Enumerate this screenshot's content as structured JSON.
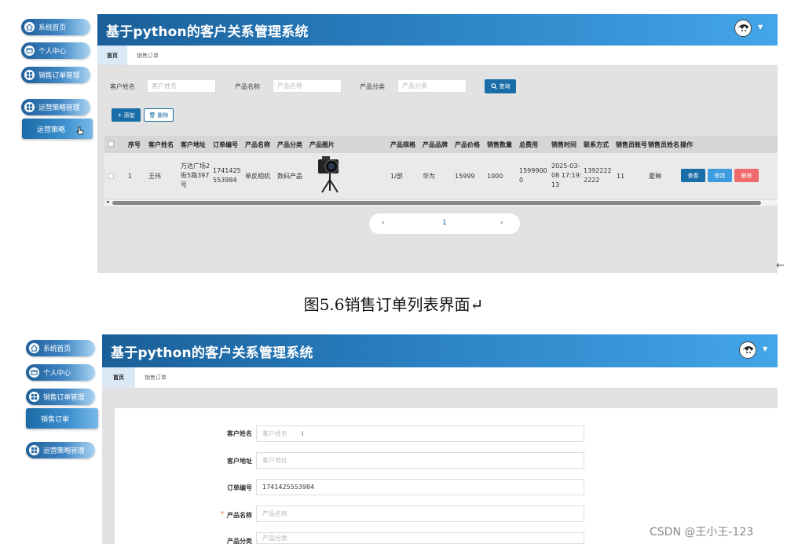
{
  "app_title": "基于python的客户关系管理系统",
  "sidebar": {
    "items": [
      "系统首页",
      "个人中心",
      "销售订单管理",
      "运营策略管理"
    ],
    "sub_strategy": "运营策略",
    "sub_order": "销售订单"
  },
  "tabs": [
    "首页",
    "销售订单"
  ],
  "filters": [
    {
      "label": "客户姓名",
      "placeholder": "客户姓名"
    },
    {
      "label": "产品名称",
      "placeholder": "产品名称"
    },
    {
      "label": "产品分类",
      "placeholder": "产品分类"
    }
  ],
  "query_label": "查询",
  "add_label": "+ 添加",
  "delete_label": "删除",
  "table": {
    "headers": [
      "序号",
      "客户姓名",
      "客户地址",
      "订单编号",
      "产品名称",
      "产品分类",
      "产品图片",
      "产品规格",
      "产品品牌",
      "产品价格",
      "销售数量",
      "总费用",
      "销售时间",
      "联系方式",
      "销售员账号",
      "销售员姓名",
      "操作"
    ],
    "row": {
      "index": "1",
      "customer": "王伟",
      "address": "万达广场2街5路397号",
      "order_no": "1741425553984",
      "product": "单反相机",
      "category": "数码产品",
      "spec": "1/部",
      "brand": "华为",
      "price": "15999",
      "qty": "1000",
      "total": "15999000",
      "time": "2025-03-08 17:19:13",
      "phone": "13922222222",
      "seller_account": "11",
      "seller_name": "夏琳"
    },
    "actions": [
      "查看",
      "修改",
      "删除"
    ]
  },
  "pager": {
    "prev": "‹",
    "page": "1",
    "next": "›"
  },
  "caption": "图5.6销售订单列表界面↵",
  "form": {
    "fields": [
      {
        "label": "客户姓名",
        "value": "",
        "placeholder": "客户姓名",
        "required": false
      },
      {
        "label": "客户地址",
        "value": "",
        "placeholder": "客户地址",
        "required": false
      },
      {
        "label": "订单编号",
        "value": "1741425553984",
        "placeholder": "",
        "required": false
      },
      {
        "label": "产品名称",
        "value": "",
        "placeholder": "产品名称",
        "required": true
      },
      {
        "label": "产品分类",
        "value": "",
        "placeholder": "产品分类",
        "required": false
      }
    ]
  },
  "watermark": "CSDN @王小王-123",
  "side_arrow": "←"
}
